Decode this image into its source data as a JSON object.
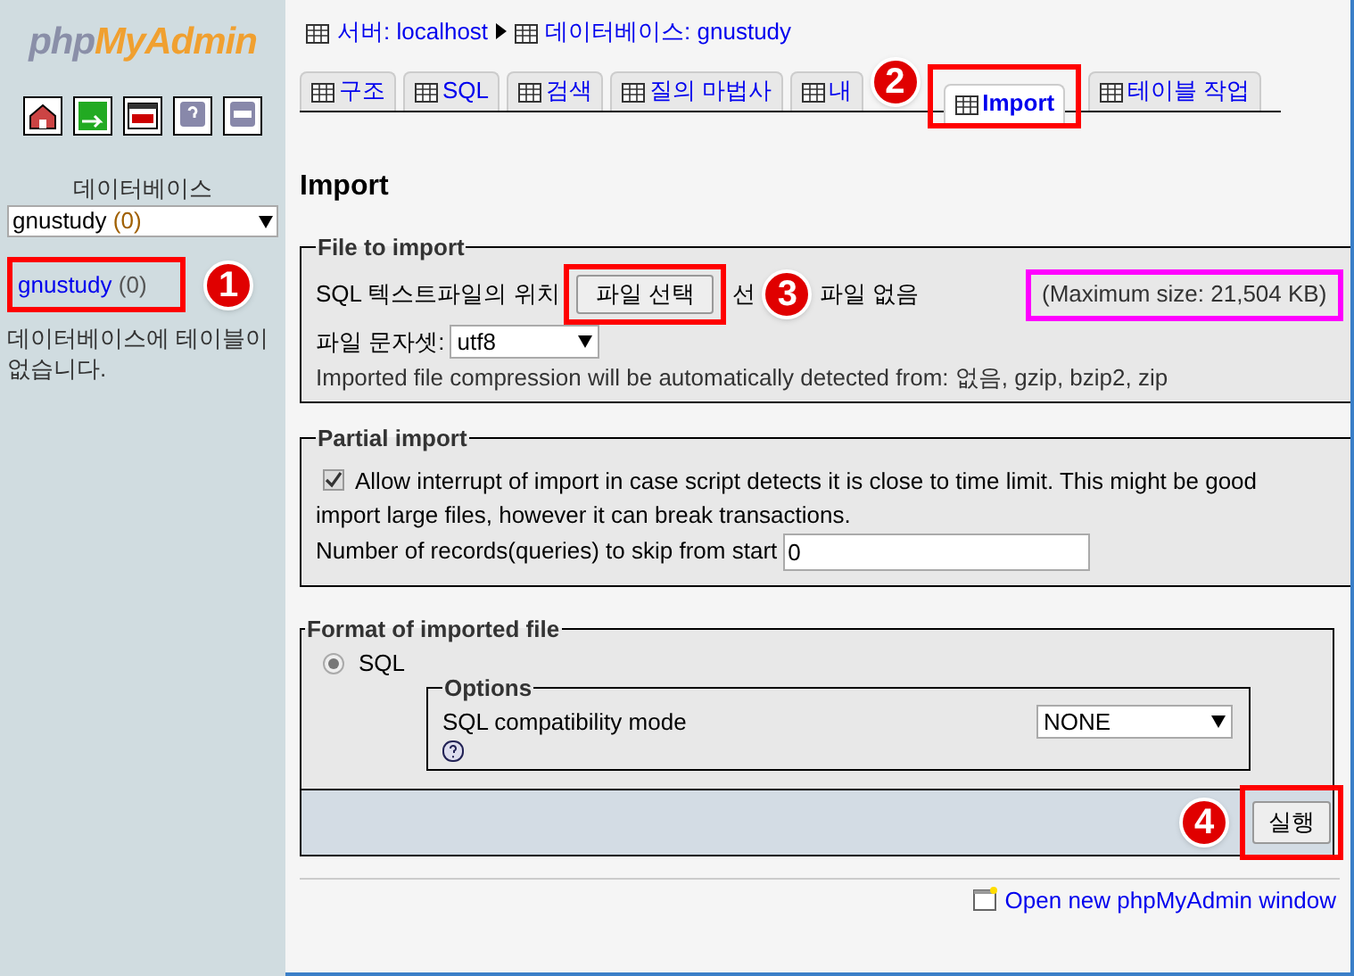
{
  "sidebar": {
    "logo": {
      "part_1": "php",
      "part_2": "MyAdmin"
    },
    "database_label": "데이터베이스",
    "database_select": {
      "value": "gnustudy",
      "count": "(0)"
    },
    "database_link": {
      "name": "gnustudy",
      "count": "(0)",
      "color": "#ff0000",
      "badge": "1"
    },
    "note": "데이터베이스에 테이블이 없습니다."
  },
  "breadcrumb": [
    "서버: localhost",
    "데이터베이스: gnustudy"
  ],
  "tabs": [
    {
      "label": "구조",
      "selected": false
    },
    {
      "label": "SQL",
      "selected": false
    },
    {
      "label": "검색",
      "selected": false
    },
    {
      "label": "질의 마법사",
      "selected": false
    },
    {
      "label": "내",
      "selected": false
    },
    {
      "label": "Import",
      "selected": true,
      "color": "#ff0000",
      "badge": "2"
    },
    {
      "label": "테이블 작업",
      "selected": false
    }
  ],
  "heading": "Import",
  "file_to_import": {
    "legend": "File to import",
    "location_label": "SQL 텍스트파일의 위치",
    "file_button": {
      "label": "파일 선택",
      "color": "#ff0000",
      "badge": "3"
    },
    "file_status_parts": [
      "선",
      "파일 없음"
    ],
    "max_size": {
      "text": "(Maximum size: 21,504 KB)",
      "color": "#ff00ff"
    },
    "charset_label": "파일 문자셋:",
    "charset_value": "utf8",
    "compression_note": "Imported file compression will be automatically detected from: 없음, gzip, bzip2, zip"
  },
  "partial_import": {
    "legend": "Partial import",
    "allow_interrupt": {
      "checked": true,
      "text": "Allow interrupt of import in case script detects it is close to time limit. This might be good",
      "continuation": "import large files, however it can break transactions."
    },
    "skip_label": "Number of records(queries) to skip from start",
    "skip_value": "0"
  },
  "format": {
    "legend": "Format of imported file",
    "formats": [
      {
        "label": "SQL",
        "selected": true
      }
    ],
    "options": {
      "legend": "Options",
      "compat_label": "SQL compatibility mode",
      "compat_value": "NONE"
    },
    "submit": {
      "label": "실행",
      "color": "#ff0000",
      "badge": "4"
    }
  },
  "footer_link": "Open new phpMyAdmin window"
}
